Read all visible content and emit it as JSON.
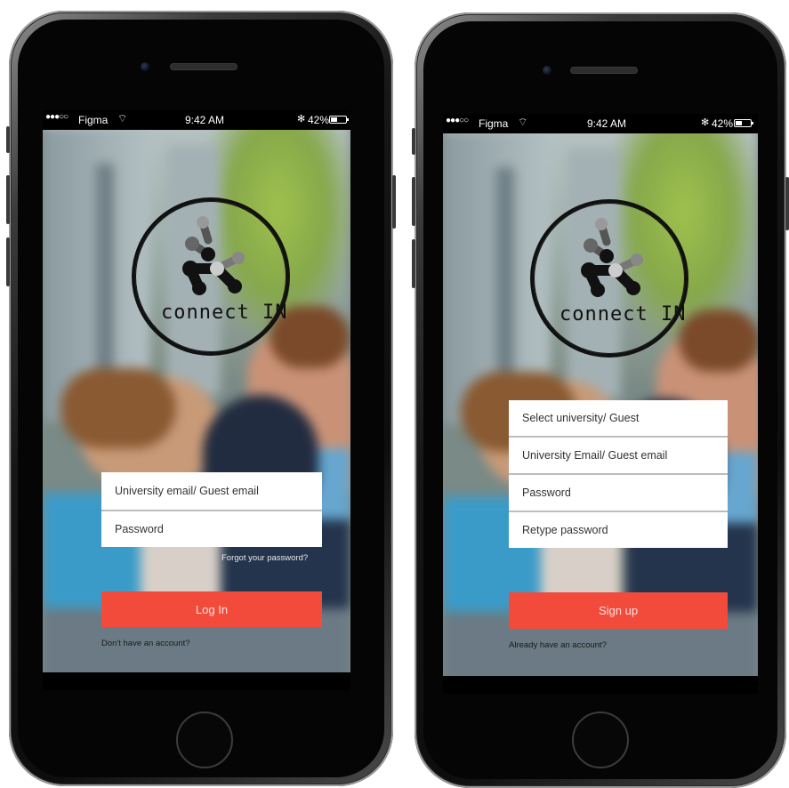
{
  "phones": [
    {
      "screen": "login",
      "status_bar": {
        "signal": "●●●○○",
        "carrier": "Figma",
        "time": "9:42 AM",
        "bluetooth": "✻",
        "battery": "42%"
      },
      "logo": {
        "text": "connect  IN",
        "icon": "molecule-logo-icon"
      },
      "fields": [
        {
          "placeholder": "University email/ Guest email"
        },
        {
          "placeholder": "Password"
        }
      ],
      "forgot_link": "Forgot your password?",
      "button_label": "Log In",
      "footer_link": "Don't have an account?"
    },
    {
      "screen": "signup",
      "status_bar": {
        "signal": "●●●○○",
        "carrier": "Figma",
        "time": "9:42 AM",
        "bluetooth": "✻",
        "battery": "42%"
      },
      "logo": {
        "text": "connect  IN",
        "icon": "molecule-logo-icon"
      },
      "fields": [
        {
          "placeholder": "Select university/ Guest"
        },
        {
          "placeholder": "University Email/ Guest email"
        },
        {
          "placeholder": "Password"
        },
        {
          "placeholder": "Retype password"
        }
      ],
      "button_label": "Sign up",
      "footer_link": "Already have an account?"
    }
  ],
  "colors": {
    "accent": "#f24b3c",
    "field_bg": "#ffffff",
    "phone_body": "#0d0d0d"
  }
}
